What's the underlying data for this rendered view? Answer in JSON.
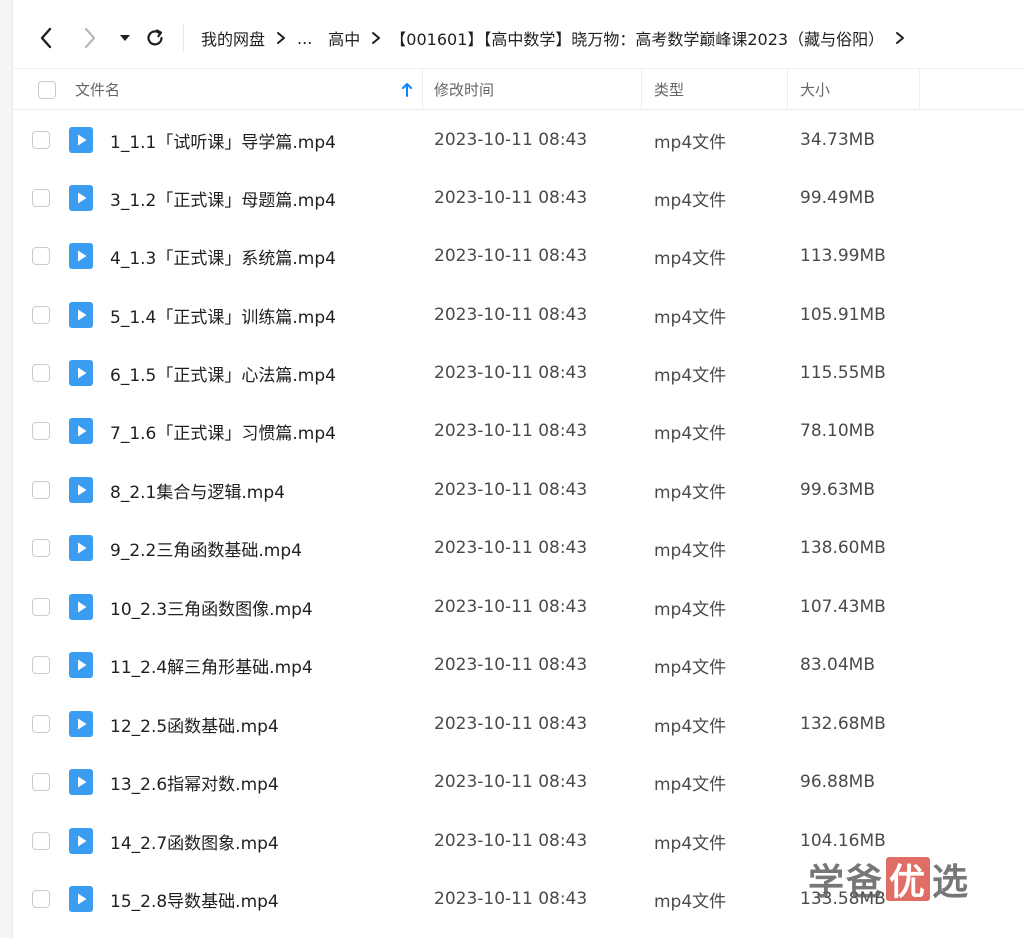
{
  "nav": {
    "breadcrumb": [
      "我的网盘",
      "...",
      "高中",
      "【001601】【高中数学】晓万物：高考数学巅峰课2023（藏与俗阳）"
    ]
  },
  "header": {
    "name": "文件名",
    "time": "修改时间",
    "type": "类型",
    "size": "大小"
  },
  "files": [
    {
      "name": "1_1.1「试听课」导学篇.mp4",
      "time": "2023-10-11 08:43",
      "type": "mp4文件",
      "size": "34.73MB"
    },
    {
      "name": "3_1.2「正式课」母题篇.mp4",
      "time": "2023-10-11 08:43",
      "type": "mp4文件",
      "size": "99.49MB"
    },
    {
      "name": "4_1.3「正式课」系统篇.mp4",
      "time": "2023-10-11 08:43",
      "type": "mp4文件",
      "size": "113.99MB"
    },
    {
      "name": "5_1.4「正式课」训练篇.mp4",
      "time": "2023-10-11 08:43",
      "type": "mp4文件",
      "size": "105.91MB"
    },
    {
      "name": "6_1.5「正式课」心法篇.mp4",
      "time": "2023-10-11 08:43",
      "type": "mp4文件",
      "size": "115.55MB"
    },
    {
      "name": "7_1.6「正式课」习惯篇.mp4",
      "time": "2023-10-11 08:43",
      "type": "mp4文件",
      "size": "78.10MB"
    },
    {
      "name": "8_2.1集合与逻辑.mp4",
      "time": "2023-10-11 08:43",
      "type": "mp4文件",
      "size": "99.63MB"
    },
    {
      "name": "9_2.2三角函数基础.mp4",
      "time": "2023-10-11 08:43",
      "type": "mp4文件",
      "size": "138.60MB"
    },
    {
      "name": "10_2.3三角函数图像.mp4",
      "time": "2023-10-11 08:43",
      "type": "mp4文件",
      "size": "107.43MB"
    },
    {
      "name": "11_2.4解三角形基础.mp4",
      "time": "2023-10-11 08:43",
      "type": "mp4文件",
      "size": "83.04MB"
    },
    {
      "name": "12_2.5函数基础.mp4",
      "time": "2023-10-11 08:43",
      "type": "mp4文件",
      "size": "132.68MB"
    },
    {
      "name": "13_2.6指幂对数.mp4",
      "time": "2023-10-11 08:43",
      "type": "mp4文件",
      "size": "96.88MB"
    },
    {
      "name": "14_2.7函数图象.mp4",
      "time": "2023-10-11 08:43",
      "type": "mp4文件",
      "size": "104.16MB"
    },
    {
      "name": "15_2.8导数基础.mp4",
      "time": "2023-10-11 08:43",
      "type": "mp4文件",
      "size": "133.58MB"
    }
  ],
  "watermark": {
    "part1": "学爸",
    "part2": "优",
    "part3": "选"
  },
  "colors": {
    "accent": "#0a84ff",
    "file_icon": "#3a9df2",
    "watermark_red": "#dc554b"
  },
  "icons": {
    "back": "chevron-left-icon",
    "forward": "chevron-right-icon",
    "dropdown": "caret-down-icon",
    "refresh": "refresh-icon",
    "sort": "sort-arrow-up-icon",
    "file": "video-file-icon"
  }
}
